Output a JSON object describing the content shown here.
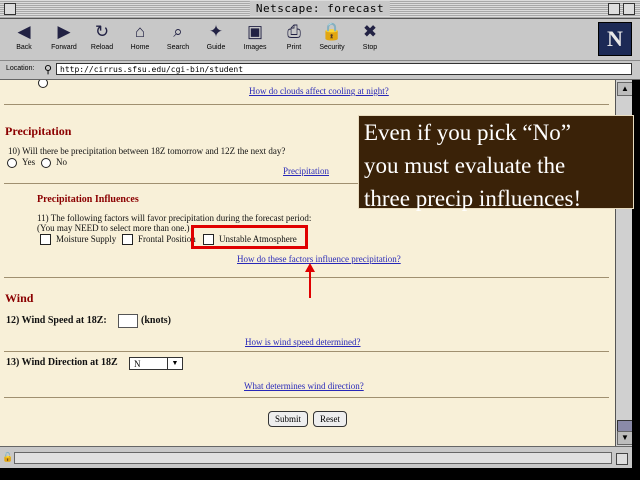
{
  "window": {
    "title": "Netscape: forecast"
  },
  "toolbar": {
    "buttons": [
      {
        "label": "Back",
        "icon": "back-arrow-icon",
        "glyph": "◀"
      },
      {
        "label": "Forward",
        "icon": "forward-arrow-icon",
        "glyph": "▶"
      },
      {
        "label": "Reload",
        "icon": "reload-icon",
        "glyph": "↻"
      },
      {
        "label": "Home",
        "icon": "home-icon",
        "glyph": "⌂"
      },
      {
        "label": "Search",
        "icon": "search-icon",
        "glyph": "⌕"
      },
      {
        "label": "Guide",
        "icon": "guide-icon",
        "glyph": "✦"
      },
      {
        "label": "Images",
        "icon": "images-icon",
        "glyph": "▣"
      },
      {
        "label": "Print",
        "icon": "print-icon",
        "glyph": "⎙"
      },
      {
        "label": "Security",
        "icon": "lock-icon",
        "glyph": "🔒"
      },
      {
        "label": "Stop",
        "icon": "stop-icon",
        "glyph": "✖"
      }
    ],
    "logo": "N"
  },
  "location": {
    "label": "Location:",
    "url": "http://cirrus.sfsu.edu/cgi-bin/student"
  },
  "page": {
    "top_link": "How do clouds affect cooling at night?",
    "precip": {
      "heading": "Precipitation",
      "q10": "10) Will there be precipitation between 18Z tomorrow and 12Z the next day?",
      "yes": "Yes",
      "no": "No",
      "link": "Precipitation"
    },
    "influences": {
      "heading": "Precipitation Influences",
      "q11_line1": "11) The following factors will favor precipitation during the forecast period:",
      "q11_line2": "(You may NEED to select more than one.)",
      "opt1": "Moisture Supply",
      "opt2": "Frontal Position",
      "opt3": "Unstable Atmosphere",
      "link": "How do these factors influence precipitation?"
    },
    "wind": {
      "heading": "Wind",
      "q12": "12) Wind Speed at 18Z:",
      "q12_unit": "(knots)",
      "q12_link": "How is wind speed determined?",
      "q13": "13) Wind Direction at 18Z",
      "q13_value": "N",
      "q13_link": "What determines wind direction?"
    },
    "submit": "Submit",
    "reset": "Reset"
  },
  "callout": {
    "line1": "Even if you pick “No”",
    "line2": "you must evaluate the",
    "line3": "three precip influences!"
  },
  "colors": {
    "heading": "#8b0000",
    "link": "#2828b8",
    "callout_bg": "#3a2208",
    "highlight": "#e00000",
    "page_bg": "#f8f0d8"
  }
}
